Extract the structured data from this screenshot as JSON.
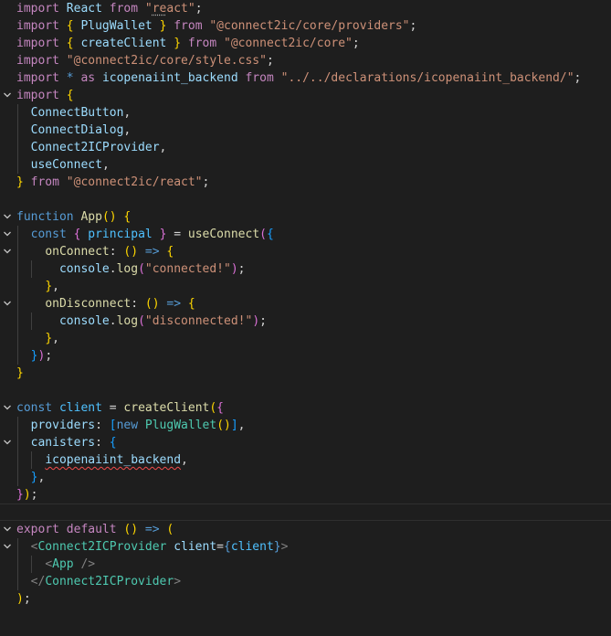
{
  "colors": {
    "background": "#1e1e1e",
    "keyword": "#c586c0",
    "storage": "#569cd6",
    "function": "#dcdcaa",
    "variable": "#9cdcfe",
    "constant": "#4fc1ff",
    "string": "#ce9178",
    "text": "#d4d4d4",
    "component": "#4ec9b0",
    "tag_punct": "#808080",
    "bracket1": "#ffd700",
    "bracket2": "#da70d6",
    "bracket3": "#179fff",
    "error_underline": "#f14c4c",
    "indent_guide": "#404040"
  },
  "editor": {
    "fold_icon": "chevron-down-icon",
    "lines": [
      {
        "fold": false,
        "tokens": [
          {
            "t": "import",
            "c": "keyword"
          },
          {
            "t": " ",
            "c": "text"
          },
          {
            "t": "React",
            "c": "variable"
          },
          {
            "t": " ",
            "c": "text"
          },
          {
            "t": "from",
            "c": "keyword"
          },
          {
            "t": " ",
            "c": "text"
          },
          {
            "t": "\"",
            "c": "string"
          },
          {
            "t": "re",
            "c": "string",
            "s": "dots"
          },
          {
            "t": "act\"",
            "c": "string"
          },
          {
            "t": ";",
            "c": "text"
          }
        ]
      },
      {
        "fold": false,
        "tokens": [
          {
            "t": "import",
            "c": "keyword"
          },
          {
            "t": " ",
            "c": "text"
          },
          {
            "t": "{",
            "c": "bracket1"
          },
          {
            "t": " ",
            "c": "text"
          },
          {
            "t": "PlugWallet",
            "c": "variable"
          },
          {
            "t": " ",
            "c": "text"
          },
          {
            "t": "}",
            "c": "bracket1"
          },
          {
            "t": " ",
            "c": "text"
          },
          {
            "t": "from",
            "c": "keyword"
          },
          {
            "t": " ",
            "c": "text"
          },
          {
            "t": "\"@connect2ic/core/providers\"",
            "c": "string"
          },
          {
            "t": ";",
            "c": "text"
          }
        ]
      },
      {
        "fold": false,
        "tokens": [
          {
            "t": "import",
            "c": "keyword"
          },
          {
            "t": " ",
            "c": "text"
          },
          {
            "t": "{",
            "c": "bracket1"
          },
          {
            "t": " ",
            "c": "text"
          },
          {
            "t": "createClient",
            "c": "variable"
          },
          {
            "t": " ",
            "c": "text"
          },
          {
            "t": "}",
            "c": "bracket1"
          },
          {
            "t": " ",
            "c": "text"
          },
          {
            "t": "from",
            "c": "keyword"
          },
          {
            "t": " ",
            "c": "text"
          },
          {
            "t": "\"@connect2ic/core\"",
            "c": "string"
          },
          {
            "t": ";",
            "c": "text"
          }
        ]
      },
      {
        "fold": false,
        "tokens": [
          {
            "t": "import",
            "c": "keyword"
          },
          {
            "t": " ",
            "c": "text"
          },
          {
            "t": "\"@connect2ic/core/style.css\"",
            "c": "string"
          },
          {
            "t": ";",
            "c": "text"
          }
        ]
      },
      {
        "fold": false,
        "tokens": [
          {
            "t": "import",
            "c": "keyword"
          },
          {
            "t": " ",
            "c": "text"
          },
          {
            "t": "*",
            "c": "storage"
          },
          {
            "t": " ",
            "c": "text"
          },
          {
            "t": "as",
            "c": "keyword"
          },
          {
            "t": " ",
            "c": "text"
          },
          {
            "t": "icopenaiint_backend",
            "c": "variable"
          },
          {
            "t": " ",
            "c": "text"
          },
          {
            "t": "from",
            "c": "keyword"
          },
          {
            "t": " ",
            "c": "text"
          },
          {
            "t": "\"../../declarations/icopenaiint_backend/\"",
            "c": "string"
          },
          {
            "t": ";",
            "c": "text"
          }
        ]
      },
      {
        "fold": true,
        "tokens": [
          {
            "t": "import",
            "c": "keyword"
          },
          {
            "t": " ",
            "c": "text"
          },
          {
            "t": "{",
            "c": "bracket1"
          }
        ]
      },
      {
        "fold": false,
        "tokens": [
          {
            "t": "  ",
            "c": "text"
          },
          {
            "t": "ConnectButton",
            "c": "variable"
          },
          {
            "t": ",",
            "c": "text"
          }
        ]
      },
      {
        "fold": false,
        "tokens": [
          {
            "t": "  ",
            "c": "text"
          },
          {
            "t": "ConnectDialog",
            "c": "variable"
          },
          {
            "t": ",",
            "c": "text"
          }
        ]
      },
      {
        "fold": false,
        "tokens": [
          {
            "t": "  ",
            "c": "text"
          },
          {
            "t": "Connect2ICProvider",
            "c": "variable"
          },
          {
            "t": ",",
            "c": "text"
          }
        ]
      },
      {
        "fold": false,
        "tokens": [
          {
            "t": "  ",
            "c": "text"
          },
          {
            "t": "useConnect",
            "c": "variable"
          },
          {
            "t": ",",
            "c": "text"
          }
        ]
      },
      {
        "fold": false,
        "tokens": [
          {
            "t": "}",
            "c": "bracket1"
          },
          {
            "t": " ",
            "c": "text"
          },
          {
            "t": "from",
            "c": "keyword"
          },
          {
            "t": " ",
            "c": "text"
          },
          {
            "t": "\"@connect2ic/react\"",
            "c": "string"
          },
          {
            "t": ";",
            "c": "text"
          }
        ]
      },
      {
        "fold": false,
        "tokens": []
      },
      {
        "fold": true,
        "tokens": [
          {
            "t": "function",
            "c": "storage"
          },
          {
            "t": " ",
            "c": "text"
          },
          {
            "t": "App",
            "c": "function"
          },
          {
            "t": "()",
            "c": "bracket1"
          },
          {
            "t": " ",
            "c": "text"
          },
          {
            "t": "{",
            "c": "bracket1"
          }
        ]
      },
      {
        "fold": true,
        "tokens": [
          {
            "t": "  ",
            "c": "text"
          },
          {
            "t": "const",
            "c": "storage"
          },
          {
            "t": " ",
            "c": "text"
          },
          {
            "t": "{",
            "c": "bracket2"
          },
          {
            "t": " ",
            "c": "text"
          },
          {
            "t": "principal",
            "c": "constant"
          },
          {
            "t": " ",
            "c": "text"
          },
          {
            "t": "}",
            "c": "bracket2"
          },
          {
            "t": " = ",
            "c": "text"
          },
          {
            "t": "useConnect",
            "c": "function"
          },
          {
            "t": "(",
            "c": "bracket2"
          },
          {
            "t": "{",
            "c": "bracket3"
          }
        ]
      },
      {
        "fold": true,
        "tokens": [
          {
            "t": "    ",
            "c": "text"
          },
          {
            "t": "onConnect",
            "c": "function"
          },
          {
            "t": ": ",
            "c": "text"
          },
          {
            "t": "()",
            "c": "bracket1"
          },
          {
            "t": " ",
            "c": "text"
          },
          {
            "t": "=>",
            "c": "storage"
          },
          {
            "t": " ",
            "c": "text"
          },
          {
            "t": "{",
            "c": "bracket1"
          }
        ]
      },
      {
        "fold": false,
        "tokens": [
          {
            "t": "      ",
            "c": "text"
          },
          {
            "t": "console",
            "c": "variable"
          },
          {
            "t": ".",
            "c": "text"
          },
          {
            "t": "log",
            "c": "function"
          },
          {
            "t": "(",
            "c": "bracket2"
          },
          {
            "t": "\"connected!\"",
            "c": "string"
          },
          {
            "t": ")",
            "c": "bracket2"
          },
          {
            "t": ";",
            "c": "text"
          }
        ]
      },
      {
        "fold": false,
        "tokens": [
          {
            "t": "    ",
            "c": "text"
          },
          {
            "t": "}",
            "c": "bracket1"
          },
          {
            "t": ",",
            "c": "text"
          }
        ]
      },
      {
        "fold": true,
        "tokens": [
          {
            "t": "    ",
            "c": "text"
          },
          {
            "t": "onDisconnect",
            "c": "function"
          },
          {
            "t": ": ",
            "c": "text"
          },
          {
            "t": "()",
            "c": "bracket1"
          },
          {
            "t": " ",
            "c": "text"
          },
          {
            "t": "=>",
            "c": "storage"
          },
          {
            "t": " ",
            "c": "text"
          },
          {
            "t": "{",
            "c": "bracket1"
          }
        ]
      },
      {
        "fold": false,
        "tokens": [
          {
            "t": "      ",
            "c": "text"
          },
          {
            "t": "console",
            "c": "variable"
          },
          {
            "t": ".",
            "c": "text"
          },
          {
            "t": "log",
            "c": "function"
          },
          {
            "t": "(",
            "c": "bracket2"
          },
          {
            "t": "\"disconnected!\"",
            "c": "string"
          },
          {
            "t": ")",
            "c": "bracket2"
          },
          {
            "t": ";",
            "c": "text"
          }
        ]
      },
      {
        "fold": false,
        "tokens": [
          {
            "t": "    ",
            "c": "text"
          },
          {
            "t": "}",
            "c": "bracket1"
          },
          {
            "t": ",",
            "c": "text"
          }
        ]
      },
      {
        "fold": false,
        "tokens": [
          {
            "t": "  ",
            "c": "text"
          },
          {
            "t": "}",
            "c": "bracket3"
          },
          {
            "t": ")",
            "c": "bracket2"
          },
          {
            "t": ";",
            "c": "text"
          }
        ]
      },
      {
        "fold": false,
        "tokens": [
          {
            "t": "}",
            "c": "bracket1"
          }
        ]
      },
      {
        "fold": false,
        "tokens": []
      },
      {
        "fold": true,
        "tokens": [
          {
            "t": "const",
            "c": "storage"
          },
          {
            "t": " ",
            "c": "text"
          },
          {
            "t": "client",
            "c": "constant"
          },
          {
            "t": " = ",
            "c": "text"
          },
          {
            "t": "createClient",
            "c": "function"
          },
          {
            "t": "(",
            "c": "bracket1"
          },
          {
            "t": "{",
            "c": "bracket2"
          }
        ]
      },
      {
        "fold": false,
        "tokens": [
          {
            "t": "  ",
            "c": "text"
          },
          {
            "t": "providers",
            "c": "variable"
          },
          {
            "t": ": ",
            "c": "text"
          },
          {
            "t": "[",
            "c": "bracket3"
          },
          {
            "t": "new",
            "c": "storage"
          },
          {
            "t": " ",
            "c": "text"
          },
          {
            "t": "PlugWallet",
            "c": "component"
          },
          {
            "t": "()",
            "c": "bracket1"
          },
          {
            "t": "]",
            "c": "bracket3"
          },
          {
            "t": ",",
            "c": "text"
          }
        ]
      },
      {
        "fold": true,
        "tokens": [
          {
            "t": "  ",
            "c": "text"
          },
          {
            "t": "canisters",
            "c": "variable"
          },
          {
            "t": ": ",
            "c": "text"
          },
          {
            "t": "{",
            "c": "bracket3"
          }
        ]
      },
      {
        "fold": false,
        "tokens": [
          {
            "t": "    ",
            "c": "text"
          },
          {
            "t": "icopenaiint_backend",
            "c": "variable",
            "s": "squiggle"
          },
          {
            "t": ",",
            "c": "text"
          }
        ]
      },
      {
        "fold": false,
        "tokens": [
          {
            "t": "  ",
            "c": "text"
          },
          {
            "t": "}",
            "c": "bracket3"
          },
          {
            "t": ",",
            "c": "text"
          }
        ]
      },
      {
        "fold": false,
        "tokens": [
          {
            "t": "}",
            "c": "bracket2"
          },
          {
            "t": ")",
            "c": "bracket1"
          },
          {
            "t": ";",
            "c": "text"
          }
        ]
      },
      {
        "fold": false,
        "current": true,
        "tokens": []
      },
      {
        "fold": true,
        "tokens": [
          {
            "t": "export",
            "c": "keyword"
          },
          {
            "t": " ",
            "c": "text"
          },
          {
            "t": "default",
            "c": "keyword"
          },
          {
            "t": " ",
            "c": "text"
          },
          {
            "t": "()",
            "c": "bracket1"
          },
          {
            "t": " ",
            "c": "text"
          },
          {
            "t": "=>",
            "c": "storage"
          },
          {
            "t": " ",
            "c": "text"
          },
          {
            "t": "(",
            "c": "bracket1"
          }
        ]
      },
      {
        "fold": true,
        "tokens": [
          {
            "t": "  ",
            "c": "text"
          },
          {
            "t": "<",
            "c": "tag_punct"
          },
          {
            "t": "Connect2ICProvider",
            "c": "component"
          },
          {
            "t": " ",
            "c": "text"
          },
          {
            "t": "client",
            "c": "variable"
          },
          {
            "t": "=",
            "c": "text"
          },
          {
            "t": "{",
            "c": "storage"
          },
          {
            "t": "client",
            "c": "constant"
          },
          {
            "t": "}",
            "c": "storage"
          },
          {
            "t": ">",
            "c": "tag_punct"
          }
        ]
      },
      {
        "fold": false,
        "tokens": [
          {
            "t": "    ",
            "c": "text"
          },
          {
            "t": "<",
            "c": "tag_punct"
          },
          {
            "t": "App",
            "c": "component"
          },
          {
            "t": " ",
            "c": "text"
          },
          {
            "t": "/>",
            "c": "tag_punct"
          }
        ]
      },
      {
        "fold": false,
        "tokens": [
          {
            "t": "  ",
            "c": "text"
          },
          {
            "t": "</",
            "c": "tag_punct"
          },
          {
            "t": "Connect2ICProvider",
            "c": "component"
          },
          {
            "t": ">",
            "c": "tag_punct"
          }
        ]
      },
      {
        "fold": false,
        "tokens": [
          {
            "t": ")",
            "c": "bracket1"
          },
          {
            "t": ";",
            "c": "text"
          }
        ]
      }
    ]
  }
}
